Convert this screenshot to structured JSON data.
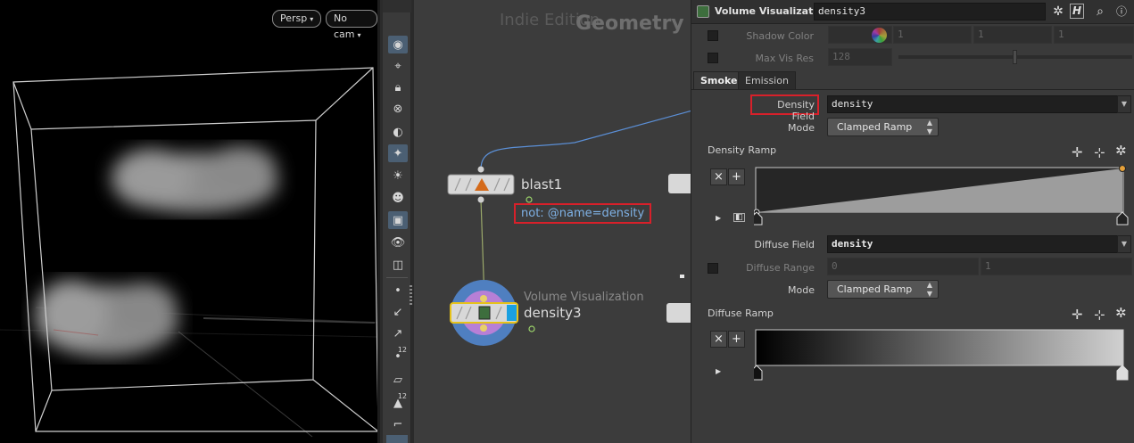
{
  "viewport": {
    "camera_menu": "Persp",
    "cam_menu": "No cam"
  },
  "shelf": {
    "label_12a": "12",
    "label_12b": "12"
  },
  "network": {
    "watermark": "Indie Edition",
    "context": "Geometry",
    "nodes": {
      "blast": {
        "name": "blast1",
        "comment": "not: @name=density"
      },
      "vis": {
        "type": "Volume Visualization",
        "name": "density3"
      }
    },
    "highlight_color": "#d8202a",
    "wire_color": "#5b8fd6"
  },
  "params": {
    "header": {
      "op_type": "Volume Visualization",
      "node_name": "density3"
    },
    "shadow_color": {
      "label": "Shadow Color",
      "v1": "1",
      "v2": "1",
      "v3": "1"
    },
    "max_vis_res": {
      "label": "Max Vis Res",
      "value": "128",
      "slider_fraction": 0.5
    },
    "tabs": [
      "Smoke",
      "Emission"
    ],
    "density_field": {
      "label": "Density Field",
      "value": "density"
    },
    "density_mode": {
      "label": "Mode",
      "value": "Clamped Ramp"
    },
    "density_ramp": {
      "label": "Density Ramp"
    },
    "diffuse_field": {
      "label": "Diffuse Field",
      "value": "density"
    },
    "diffuse_range": {
      "label": "Diffuse Range",
      "min": "0",
      "max": "1"
    },
    "diffuse_mode": {
      "label": "Mode",
      "value": "Clamped Ramp"
    },
    "diffuse_ramp": {
      "label": "Diffuse Ramp"
    },
    "ramp_buttons": {
      "remove": "×",
      "add": "+"
    }
  }
}
